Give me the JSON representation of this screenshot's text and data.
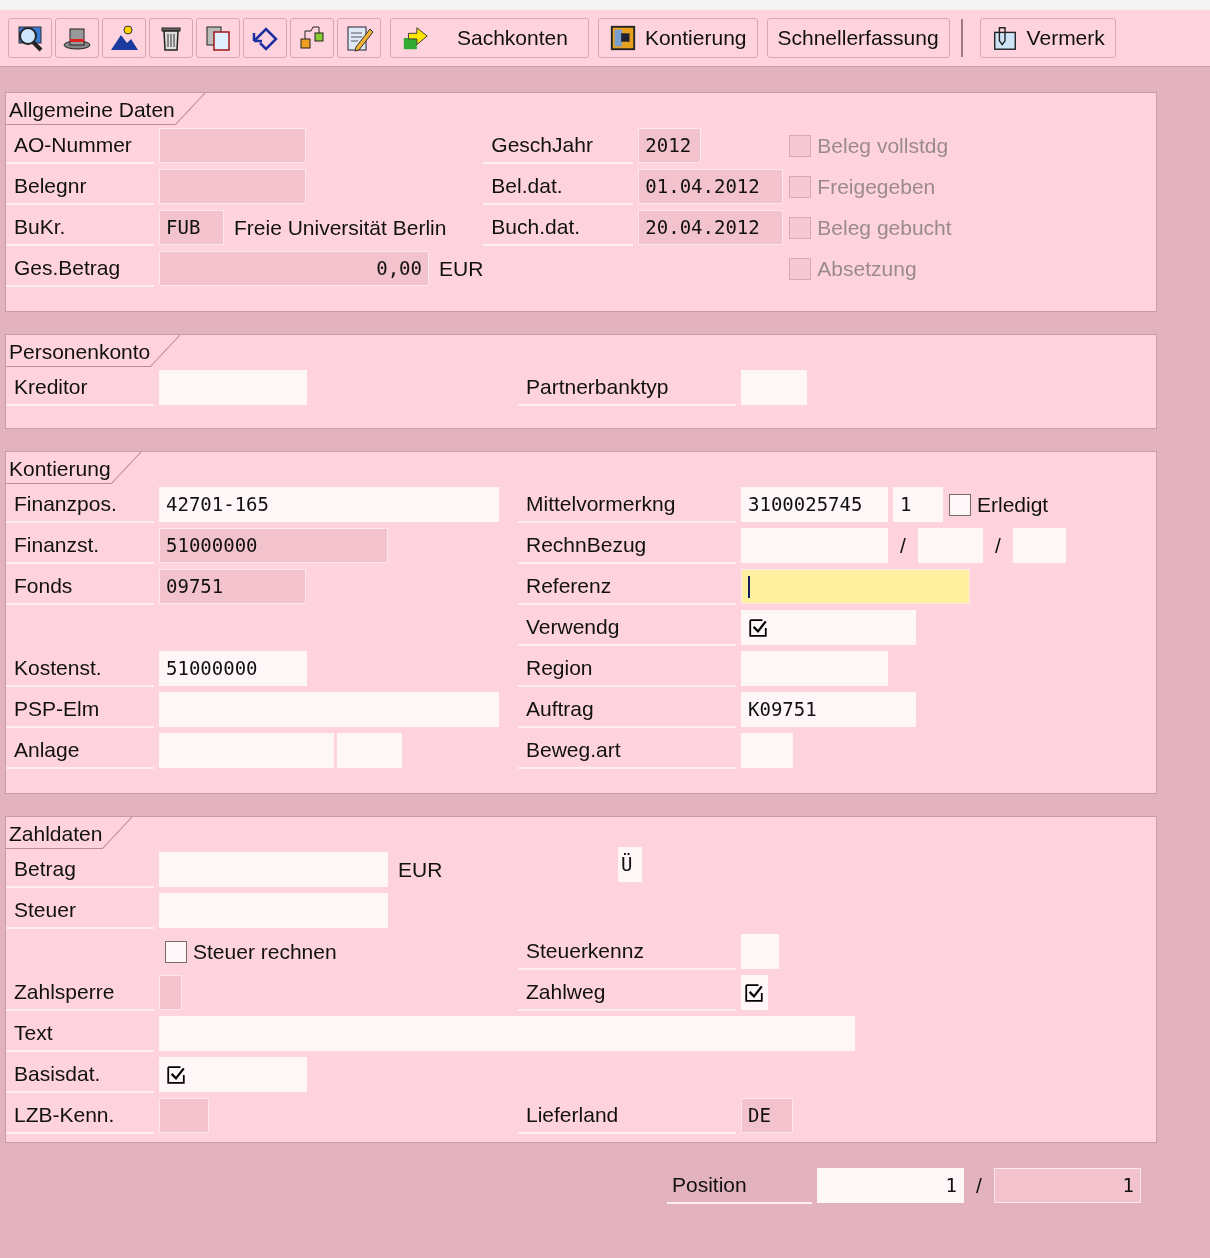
{
  "toolbar": {
    "buttons": [
      "Sachkonten",
      "Kontierung",
      "Schnellerfassung",
      "Vermerk"
    ]
  },
  "allgemeine_daten": {
    "title": "Allgemeine Daten",
    "ao_nummer": {
      "label": "AO-Nummer",
      "editable": false
    },
    "belegnr": {
      "label": "Belegnr",
      "editable": false
    },
    "bukr": {
      "label": "BuKr.",
      "value": "FUB",
      "editable": false,
      "description": "Freie Universität Berlin"
    },
    "ges_betrag": {
      "label": "Ges.Betrag",
      "value": "0,00",
      "editable": false,
      "currency": "EUR"
    },
    "geschjahr": {
      "label": "GeschJahr",
      "value": "2012",
      "editable": false
    },
    "bel_dat": {
      "label": "Bel.dat.",
      "value": "01.04.2012",
      "editable": false
    },
    "buch_dat": {
      "label": "Buch.dat.",
      "value": "20.04.2012",
      "editable": false
    },
    "flags": [
      {
        "label": "Beleg vollstdg",
        "checked": false,
        "disabled": true
      },
      {
        "label": "Freigegeben",
        "checked": false,
        "disabled": true
      },
      {
        "label": "Beleg gebucht",
        "checked": false,
        "disabled": true
      },
      {
        "label": "Absetzung",
        "checked": false,
        "disabled": true
      }
    ]
  },
  "personenkonto": {
    "title": "Personenkonto",
    "kreditor": {
      "label": "Kreditor",
      "editable": true
    },
    "partnerbanktyp": {
      "label": "Partnerbanktyp",
      "editable": true
    }
  },
  "kontierung": {
    "title": "Kontierung",
    "finanzpos": {
      "label": "Finanzpos.",
      "value": "42701-165",
      "editable": true
    },
    "mittelvormerkng": {
      "label": "Mittelvormerkng",
      "parts": [
        {
          "value": "3100025745",
          "editable": true
        },
        {
          "value": "1",
          "editable": true
        }
      ]
    },
    "erledigt": {
      "label": "Erledigt",
      "checked": false,
      "disabled": false
    },
    "finanzst": {
      "label": "Finanzst.",
      "value": "51000000",
      "editable": false
    },
    "rechnbezug": {
      "label": "RechnBezug",
      "separators": [
        "/",
        "/"
      ],
      "parts": [
        {
          "editable": true
        },
        {
          "editable": true
        },
        {
          "editable": true
        }
      ]
    },
    "fonds": {
      "label": "Fonds",
      "value": "09751",
      "editable": false
    },
    "referenz": {
      "label": "Referenz",
      "focused": true
    },
    "verwendg": {
      "label": "Verwendg",
      "editable": true
    },
    "kostenst": {
      "label": "Kostenst.",
      "value": "51000000",
      "editable": true
    },
    "region": {
      "label": "Region",
      "editable": true
    },
    "psp_elm": {
      "label": "PSP-Elm",
      "editable": true
    },
    "auftrag": {
      "label": "Auftrag",
      "value": "K09751",
      "editable": true
    },
    "anlage": {
      "label": "Anlage",
      "parts": [
        {
          "editable": true
        },
        {
          "editable": true
        }
      ]
    },
    "beweg_art": {
      "label": "Beweg.art",
      "editable": true
    }
  },
  "zahldaten": {
    "title": "Zahldaten",
    "betrag": {
      "label": "Betrag",
      "editable": true,
      "currency": "EUR"
    },
    "marker_field": {
      "value": "Ü",
      "editable": true
    },
    "steuer": {
      "label": "Steuer",
      "editable": true
    },
    "steuer_rechnen": {
      "label": "Steuer rechnen",
      "checked": false,
      "disabled": false
    },
    "steuerkennz": {
      "label": "Steuerkennz",
      "editable": true
    },
    "zahlsperre": {
      "label": "Zahlsperre",
      "editable": false
    },
    "zahlweg": {
      "label": "Zahlweg",
      "editable": true
    },
    "text": {
      "label": "Text",
      "editable": true
    },
    "basisdat": {
      "label": "Basisdat.",
      "editable": true
    },
    "lzb_kenn": {
      "label": "LZB-Kenn.",
      "editable": false
    },
    "lieferland": {
      "label": "Lieferland",
      "value": "DE",
      "editable": false
    }
  },
  "footer": {
    "position": {
      "label": "Position",
      "separator": "/",
      "parts": [
        {
          "value": "1",
          "editable": true
        },
        {
          "value": "1",
          "editable": false
        }
      ]
    }
  }
}
